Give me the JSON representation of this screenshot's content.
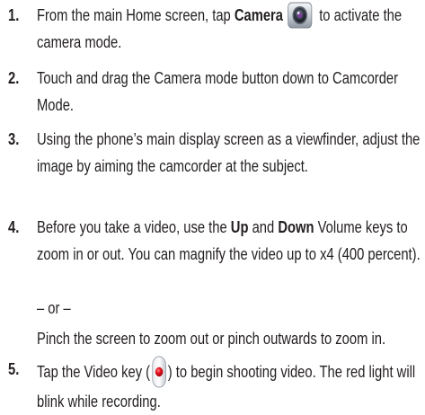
{
  "steps": [
    {
      "num": "1.",
      "pre": "From the main Home screen, tap ",
      "bold": "Camera",
      "post": " to activate the camera mode."
    },
    {
      "num": "2.",
      "text": "Touch and drag the Camera mode button down to Camcorder Mode."
    },
    {
      "num": "3.",
      "text": "Using the phone’s main display screen as a viewfinder, adjust the image by aiming the camcorder at the subject."
    },
    {
      "num": "4.",
      "pre": "Before you take a video, use the ",
      "bold1": "Up",
      "mid": " and ",
      "bold2": "Down",
      "post": " Volume keys to zoom in or out. You can magnify the video up to x4 (400 percent).",
      "or": "– or –",
      "alt": "Pinch the screen to zoom out or pinch outwards to zoom in."
    },
    {
      "num": "5.",
      "pre": "Tap the Video key (",
      "post": ") to begin shooting video. The red light will blink while recording."
    }
  ],
  "icons": {
    "camera": "camera-app-icon",
    "video": "video-record-key-icon"
  },
  "colors": {
    "text": "#231f20",
    "record_red": "#e8101c"
  }
}
